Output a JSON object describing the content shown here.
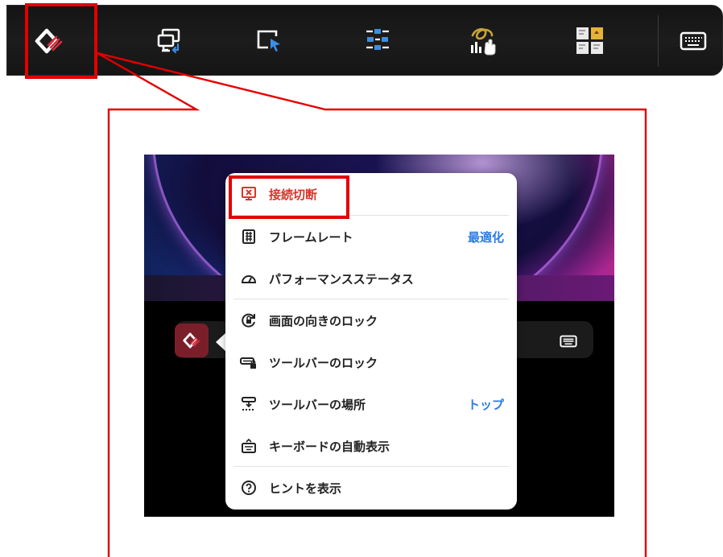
{
  "toolbar": {
    "buttons": [
      {
        "name": "remote-app-logo-icon"
      },
      {
        "name": "display-switch-icon"
      },
      {
        "name": "pointer-mode-icon"
      },
      {
        "name": "settings-panel-icon"
      },
      {
        "name": "pen-drawing-icon"
      },
      {
        "name": "sticky-notes-icon"
      },
      {
        "name": "keyboard-icon"
      }
    ]
  },
  "menu": {
    "items": [
      {
        "label": "接続切断",
        "value": "",
        "icon": "disconnect-icon",
        "color": "#d9352b"
      },
      {
        "label": "フレームレート",
        "value": "最適化",
        "icon": "frame-rate-icon"
      },
      {
        "label": "パフォーマンスステータス",
        "value": "",
        "icon": "performance-gauge-icon"
      },
      {
        "label": "画面の向きのロック",
        "value": "",
        "icon": "rotation-lock-icon"
      },
      {
        "label": "ツールバーのロック",
        "value": "",
        "icon": "toolbar-lock-icon"
      },
      {
        "label": "ツールバーの場所",
        "value": "トップ",
        "icon": "toolbar-position-icon"
      },
      {
        "label": "キーボードの自動表示",
        "value": "",
        "icon": "keyboard-auto-icon"
      },
      {
        "label": "ヒントを表示",
        "value": "",
        "icon": "help-hint-icon"
      }
    ]
  },
  "colors": {
    "highlight": "#e30000",
    "accent": "#2c7be5",
    "danger": "#d9352b"
  }
}
